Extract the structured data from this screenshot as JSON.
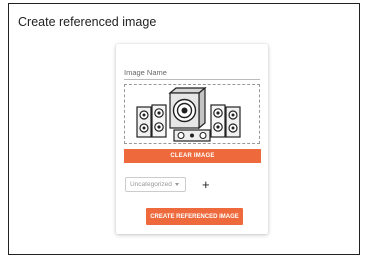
{
  "page": {
    "title": "Create referenced image"
  },
  "form": {
    "image_name_label": "Image Name",
    "clear_button_label": "CLEAR IMAGE",
    "category_select": {
      "selected": "Uncategorized"
    },
    "add_category_label": "+",
    "create_button_label": "CREATE REFERENCED IMAGE"
  },
  "image_preview": {
    "subject": "surround speaker system"
  },
  "colors": {
    "accent": "#ee6a3c",
    "border": "#222222",
    "muted_text": "#999999"
  }
}
